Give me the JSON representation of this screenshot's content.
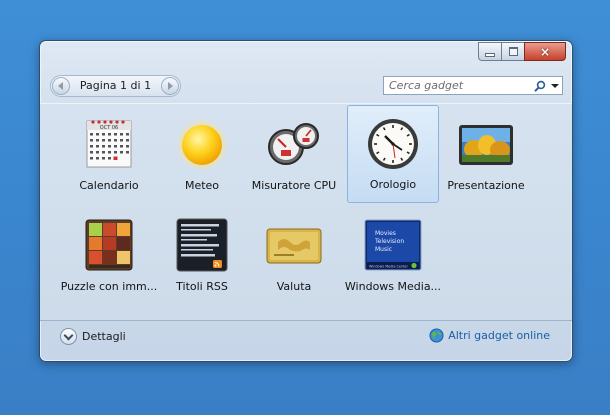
{
  "window": {
    "controls": {
      "minimize": "minimize",
      "maximize": "maximize",
      "close": "×"
    }
  },
  "toolbar": {
    "page_label": "Pagina 1 di 1",
    "search_placeholder": "Cerca gadget"
  },
  "gadgets": [
    {
      "label": "Calendario",
      "icon": "calendar-icon"
    },
    {
      "label": "Meteo",
      "icon": "weather-sun-icon"
    },
    {
      "label": "Misuratore CPU",
      "icon": "cpu-meter-icon"
    },
    {
      "label": "Orologio",
      "icon": "clock-icon",
      "selected": true
    },
    {
      "label": "Presentazione",
      "icon": "slideshow-icon"
    },
    {
      "label": "Puzzle con imm...",
      "icon": "picture-puzzle-icon"
    },
    {
      "label": "Titoli RSS",
      "icon": "rss-feed-icon"
    },
    {
      "label": "Valuta",
      "icon": "currency-card-icon"
    },
    {
      "label": "Windows Media...",
      "icon": "media-center-icon"
    }
  ],
  "calendar_icon": {
    "month": "OCT 06"
  },
  "media_icon": {
    "lines": [
      "Movies",
      "Television",
      "Music"
    ],
    "brand": "Windows Media Center"
  },
  "footer": {
    "details_label": "Dettagli",
    "online_label": "Altri gadget online"
  },
  "colors": {
    "desktop": "#3a86cf",
    "link": "#1a5ea7",
    "selection": "#c5dcf3"
  }
}
